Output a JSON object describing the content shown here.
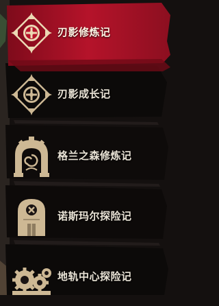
{
  "menu": {
    "active_index": 0,
    "items": [
      {
        "label": "刃影修炼记",
        "icon": "compass-cross-icon"
      },
      {
        "label": "刃影成长记",
        "icon": "compass-cross-icon"
      },
      {
        "label": "格兰之森修炼记",
        "icon": "forest-gate-icon"
      },
      {
        "label": "诺斯玛尔探险记",
        "icon": "tombstone-door-icon"
      },
      {
        "label": "地轨中心探险记",
        "icon": "gears-icon"
      }
    ]
  },
  "colors": {
    "active_band": "#b5132a",
    "icon_gold": "#d9c49d",
    "label": "#e9e3d6",
    "background": "#14100f"
  }
}
